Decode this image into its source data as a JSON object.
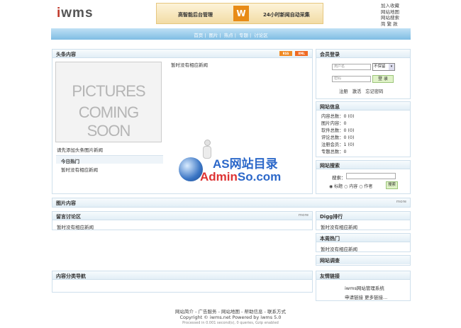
{
  "logo": {
    "first": "i",
    "rest": "wms"
  },
  "banner": {
    "left_text": "高智能后台管理",
    "icon_letter": "W",
    "right_text": "24小时新闻自动采集"
  },
  "top_links": [
    "加入收藏",
    "网站地图",
    "网站搜索",
    "简 繁 款"
  ],
  "nav": [
    "首页",
    "图片",
    "热点",
    "专题",
    "讨论区"
  ],
  "headline": {
    "title": "头条内容",
    "rss_labels": [
      "RSS",
      "XML"
    ],
    "no_news": "暂时没有相应新闻",
    "placeholder_line1": "PICTURES",
    "placeholder_line2": "COMING SOON",
    "pic_caption": "请先添加头条图片新闻",
    "hot_today_title": "今日热门",
    "hot_today_item": "暂时没有相应新闻"
  },
  "login": {
    "title": "会员登录",
    "username_placeholder": "用户名",
    "password_placeholder": "密码",
    "remember_value": "不保留",
    "login_button": "登 录",
    "links": [
      "注册",
      "激活",
      "忘记密码"
    ]
  },
  "site_info": {
    "title": "网站信息",
    "rows": [
      "内容总数：0 (0)",
      "图片内容：0",
      "软件总数：0 (0)",
      "评论总数：0 (0)",
      "注册会员：1 (0)",
      "专题总数：0"
    ]
  },
  "search": {
    "title": "网站搜索",
    "label": "搜索：",
    "options": [
      "标题",
      "内容",
      "作者"
    ],
    "button": "搜索"
  },
  "pictures": {
    "title": "图片内容",
    "more": "more"
  },
  "forum": {
    "title": "留言讨论区",
    "more": "more",
    "item": "暂时没有相应新闻"
  },
  "digg": {
    "title": "Digg排行",
    "item": "暂时没有相应新闻"
  },
  "week_hot": {
    "title": "本周热门",
    "item": "暂时没有相应新闻"
  },
  "survey": {
    "title": "网站调查"
  },
  "category_nav": {
    "title": "内容分类导航"
  },
  "friend_links": {
    "title": "友情链接",
    "item1": "iwms网站管理系统",
    "item2": "申请链接",
    "item3": "更多链接..."
  },
  "watermark": {
    "line1": "AS网站目录",
    "line2_red": "Admin",
    "line2_blue": "So.com"
  },
  "footer": {
    "links": "网站简介 - 广告服务 - 网站地图 - 帮助信息 - 联系方式",
    "copyright": "Copyright © iwms.net Powered by iwms 5.0",
    "processed": "Processed in 0.001 second(s), 0 queries, Gzip enabled"
  }
}
